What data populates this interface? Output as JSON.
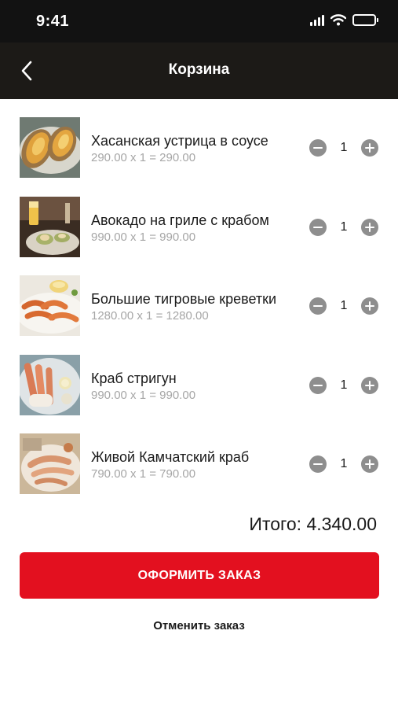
{
  "status_bar": {
    "time": "9:41",
    "icons": [
      "signal-icon",
      "wifi-icon",
      "battery-icon"
    ]
  },
  "header": {
    "back_icon": "chevron-left-icon",
    "title": "Корзина"
  },
  "cart": {
    "items": [
      {
        "name": "Хасанская устрица в соусе",
        "calc": "290.00 x 1 = 290.00",
        "quantity": "1",
        "image": "oysters-photo"
      },
      {
        "name": "Авокадо на гриле с крабом",
        "calc": "990.00 x 1 = 990.00",
        "quantity": "1",
        "image": "grilled-avocado-photo"
      },
      {
        "name": "Большие тигровые креветки",
        "calc": "1280.00 x 1 = 1280.00",
        "quantity": "1",
        "image": "tiger-shrimps-photo"
      },
      {
        "name": "Краб стригун",
        "calc": "990.00 x 1 = 990.00",
        "quantity": "1",
        "image": "snow-crab-photo"
      },
      {
        "name": "Живой Камчатский краб",
        "calc": "790.00 x 1 = 790.00",
        "quantity": "1",
        "image": "kamchatka-crab-photo"
      }
    ],
    "minus_icon": "minus-circle-icon",
    "plus_icon": "plus-circle-icon"
  },
  "summary": {
    "total": "Итого: 4.340.00"
  },
  "actions": {
    "checkout_label": "ОФОРМИТЬ ЗАКАЗ",
    "cancel_label": "Отменить заказ"
  },
  "colors": {
    "header_bg": "#1c1a17",
    "accent": "#e3101f",
    "stepper_gray": "#8e8e8e",
    "secondary_text": "#a6a6a6"
  }
}
